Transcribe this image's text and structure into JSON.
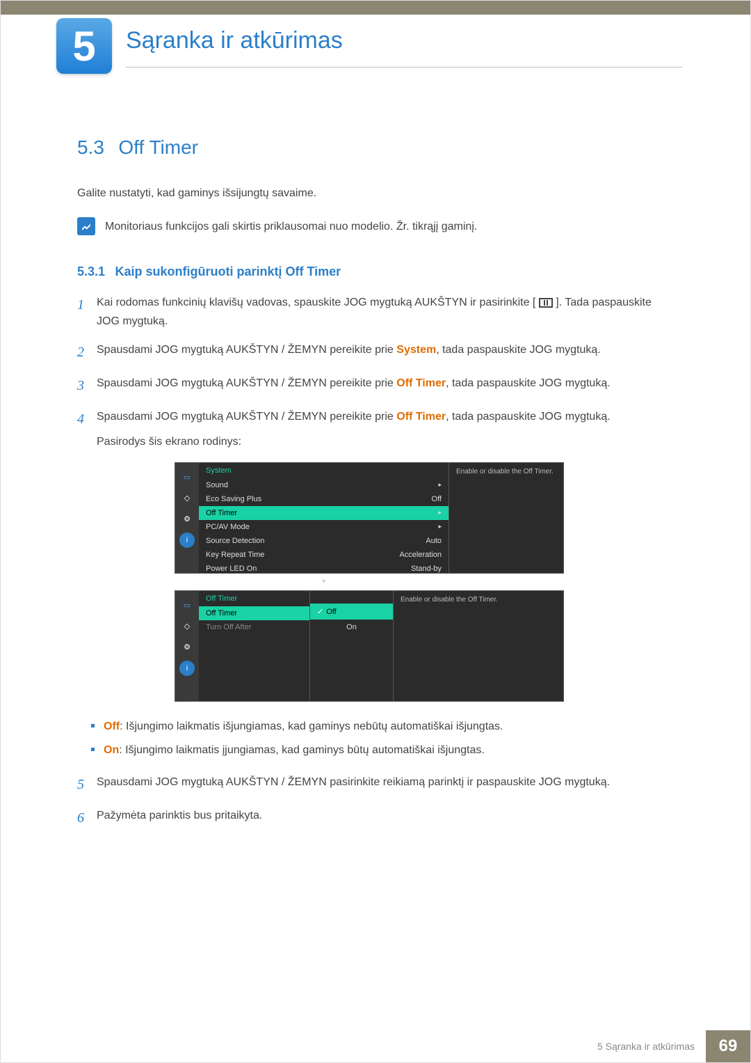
{
  "chapter": {
    "number": "5",
    "title": "Sąranka ir atkūrimas"
  },
  "section": {
    "number": "5.3",
    "title": "Off Timer"
  },
  "intro": "Galite nustatyti, kad gaminys išsijungtų savaime.",
  "note": "Monitoriaus funkcijos gali skirtis priklausomai nuo modelio. Žr. tikrąjį gaminį.",
  "subsection": {
    "number": "5.3.1",
    "title": "Kaip sukonfigūruoti parinktį Off Timer"
  },
  "steps": {
    "s1a": "Kai rodomas funkcinių klavišų vadovas, spauskite JOG mygtuką AUKŠTYN ir pasirinkite [",
    "s1b": "]. Tada paspauskite JOG mygtuką.",
    "s2a": "Spausdami JOG mygtuką AUKŠTYN / ŽEMYN pereikite prie ",
    "s2hl": "System",
    "s2b": ", tada paspauskite JOG mygtuką.",
    "s3a": "Spausdami JOG mygtuką AUKŠTYN / ŽEMYN pereikite prie ",
    "s3hl": "Off Timer",
    "s3b": ", tada paspauskite JOG mygtuką.",
    "s4a": "Spausdami JOG mygtuką AUKŠTYN / ŽEMYN pereikite prie ",
    "s4hl": "Off Timer",
    "s4b": ", tada paspauskite JOG mygtuką.",
    "s4c": "Pasirodys šis ekrano rodinys:",
    "s5": "Spausdami JOG mygtuką AUKŠTYN / ŽEMYN pasirinkite reikiamą parinktį ir paspauskite JOG mygtuką.",
    "s6": "Pažymėta parinktis bus pritaikyta."
  },
  "bullets": {
    "off_label": "Off",
    "off_text": ": Išjungimo laikmatis išjungiamas, kad gaminys nebūtų automatiškai išjungtas.",
    "on_label": "On",
    "on_text": ": Išjungimo laikmatis įjungiamas, kad gaminys būtų automatiškai išjungtas."
  },
  "osd1": {
    "header": "System",
    "rows": [
      {
        "label": "Sound",
        "value": "▸"
      },
      {
        "label": "Eco Saving Plus",
        "value": "Off"
      },
      {
        "label": "Off Timer",
        "value": "▸",
        "selected": true
      },
      {
        "label": "PC/AV Mode",
        "value": "▸"
      },
      {
        "label": "Source Detection",
        "value": "Auto"
      },
      {
        "label": "Key Repeat Time",
        "value": "Acceleration"
      },
      {
        "label": "Power LED On",
        "value": "Stand-by"
      }
    ],
    "desc": "Enable or disable the Off Timer."
  },
  "osd2": {
    "header": "Off Timer",
    "rows": [
      {
        "label": "Off Timer",
        "selected": true
      },
      {
        "label": "Turn Off After",
        "dim": true
      }
    ],
    "sub": [
      {
        "label": "Off",
        "selected": true,
        "check": true
      },
      {
        "label": "On"
      }
    ],
    "desc": "Enable or disable the Off Timer."
  },
  "footer": {
    "text": "5 Sąranka ir atkūrimas",
    "page": "69"
  }
}
